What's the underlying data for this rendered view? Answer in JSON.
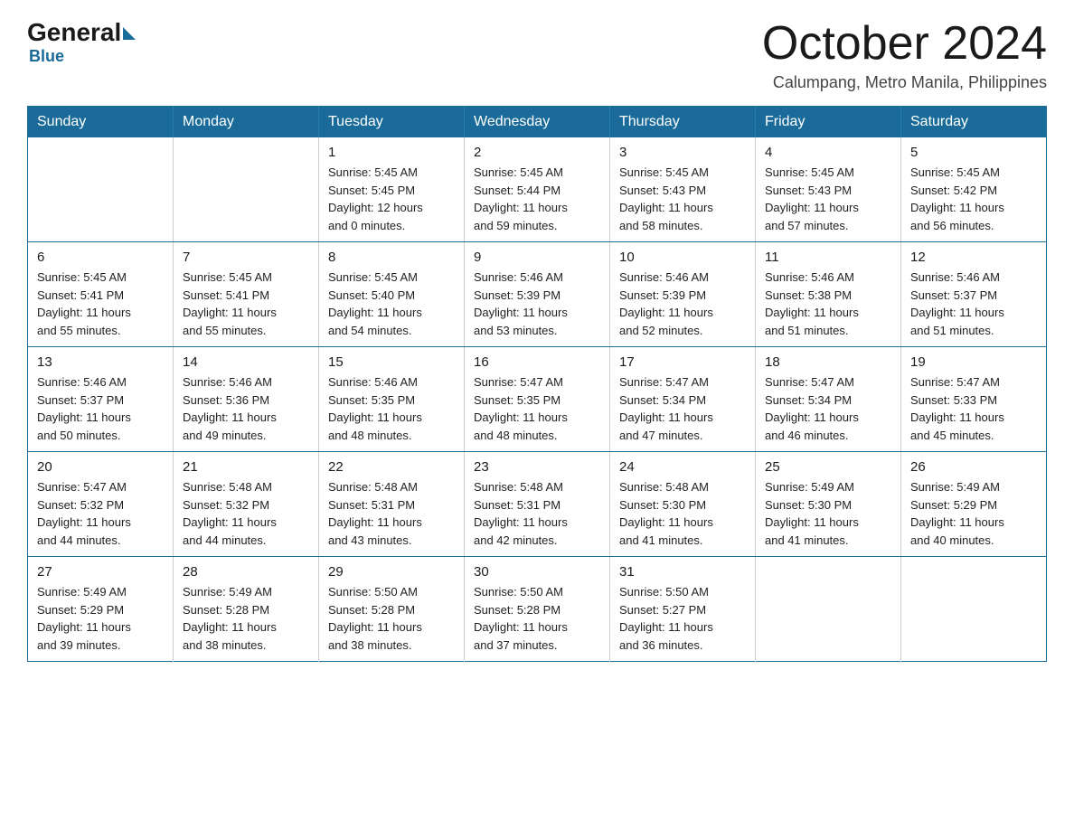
{
  "logo": {
    "general": "General",
    "blue": "Blue"
  },
  "header": {
    "title": "October 2024",
    "subtitle": "Calumpang, Metro Manila, Philippines"
  },
  "weekdays": [
    "Sunday",
    "Monday",
    "Tuesday",
    "Wednesday",
    "Thursday",
    "Friday",
    "Saturday"
  ],
  "weeks": [
    [
      {
        "day": "",
        "info": ""
      },
      {
        "day": "",
        "info": ""
      },
      {
        "day": "1",
        "info": "Sunrise: 5:45 AM\nSunset: 5:45 PM\nDaylight: 12 hours\nand 0 minutes."
      },
      {
        "day": "2",
        "info": "Sunrise: 5:45 AM\nSunset: 5:44 PM\nDaylight: 11 hours\nand 59 minutes."
      },
      {
        "day": "3",
        "info": "Sunrise: 5:45 AM\nSunset: 5:43 PM\nDaylight: 11 hours\nand 58 minutes."
      },
      {
        "day": "4",
        "info": "Sunrise: 5:45 AM\nSunset: 5:43 PM\nDaylight: 11 hours\nand 57 minutes."
      },
      {
        "day": "5",
        "info": "Sunrise: 5:45 AM\nSunset: 5:42 PM\nDaylight: 11 hours\nand 56 minutes."
      }
    ],
    [
      {
        "day": "6",
        "info": "Sunrise: 5:45 AM\nSunset: 5:41 PM\nDaylight: 11 hours\nand 55 minutes."
      },
      {
        "day": "7",
        "info": "Sunrise: 5:45 AM\nSunset: 5:41 PM\nDaylight: 11 hours\nand 55 minutes."
      },
      {
        "day": "8",
        "info": "Sunrise: 5:45 AM\nSunset: 5:40 PM\nDaylight: 11 hours\nand 54 minutes."
      },
      {
        "day": "9",
        "info": "Sunrise: 5:46 AM\nSunset: 5:39 PM\nDaylight: 11 hours\nand 53 minutes."
      },
      {
        "day": "10",
        "info": "Sunrise: 5:46 AM\nSunset: 5:39 PM\nDaylight: 11 hours\nand 52 minutes."
      },
      {
        "day": "11",
        "info": "Sunrise: 5:46 AM\nSunset: 5:38 PM\nDaylight: 11 hours\nand 51 minutes."
      },
      {
        "day": "12",
        "info": "Sunrise: 5:46 AM\nSunset: 5:37 PM\nDaylight: 11 hours\nand 51 minutes."
      }
    ],
    [
      {
        "day": "13",
        "info": "Sunrise: 5:46 AM\nSunset: 5:37 PM\nDaylight: 11 hours\nand 50 minutes."
      },
      {
        "day": "14",
        "info": "Sunrise: 5:46 AM\nSunset: 5:36 PM\nDaylight: 11 hours\nand 49 minutes."
      },
      {
        "day": "15",
        "info": "Sunrise: 5:46 AM\nSunset: 5:35 PM\nDaylight: 11 hours\nand 48 minutes."
      },
      {
        "day": "16",
        "info": "Sunrise: 5:47 AM\nSunset: 5:35 PM\nDaylight: 11 hours\nand 48 minutes."
      },
      {
        "day": "17",
        "info": "Sunrise: 5:47 AM\nSunset: 5:34 PM\nDaylight: 11 hours\nand 47 minutes."
      },
      {
        "day": "18",
        "info": "Sunrise: 5:47 AM\nSunset: 5:34 PM\nDaylight: 11 hours\nand 46 minutes."
      },
      {
        "day": "19",
        "info": "Sunrise: 5:47 AM\nSunset: 5:33 PM\nDaylight: 11 hours\nand 45 minutes."
      }
    ],
    [
      {
        "day": "20",
        "info": "Sunrise: 5:47 AM\nSunset: 5:32 PM\nDaylight: 11 hours\nand 44 minutes."
      },
      {
        "day": "21",
        "info": "Sunrise: 5:48 AM\nSunset: 5:32 PM\nDaylight: 11 hours\nand 44 minutes."
      },
      {
        "day": "22",
        "info": "Sunrise: 5:48 AM\nSunset: 5:31 PM\nDaylight: 11 hours\nand 43 minutes."
      },
      {
        "day": "23",
        "info": "Sunrise: 5:48 AM\nSunset: 5:31 PM\nDaylight: 11 hours\nand 42 minutes."
      },
      {
        "day": "24",
        "info": "Sunrise: 5:48 AM\nSunset: 5:30 PM\nDaylight: 11 hours\nand 41 minutes."
      },
      {
        "day": "25",
        "info": "Sunrise: 5:49 AM\nSunset: 5:30 PM\nDaylight: 11 hours\nand 41 minutes."
      },
      {
        "day": "26",
        "info": "Sunrise: 5:49 AM\nSunset: 5:29 PM\nDaylight: 11 hours\nand 40 minutes."
      }
    ],
    [
      {
        "day": "27",
        "info": "Sunrise: 5:49 AM\nSunset: 5:29 PM\nDaylight: 11 hours\nand 39 minutes."
      },
      {
        "day": "28",
        "info": "Sunrise: 5:49 AM\nSunset: 5:28 PM\nDaylight: 11 hours\nand 38 minutes."
      },
      {
        "day": "29",
        "info": "Sunrise: 5:50 AM\nSunset: 5:28 PM\nDaylight: 11 hours\nand 38 minutes."
      },
      {
        "day": "30",
        "info": "Sunrise: 5:50 AM\nSunset: 5:28 PM\nDaylight: 11 hours\nand 37 minutes."
      },
      {
        "day": "31",
        "info": "Sunrise: 5:50 AM\nSunset: 5:27 PM\nDaylight: 11 hours\nand 36 minutes."
      },
      {
        "day": "",
        "info": ""
      },
      {
        "day": "",
        "info": ""
      }
    ]
  ]
}
